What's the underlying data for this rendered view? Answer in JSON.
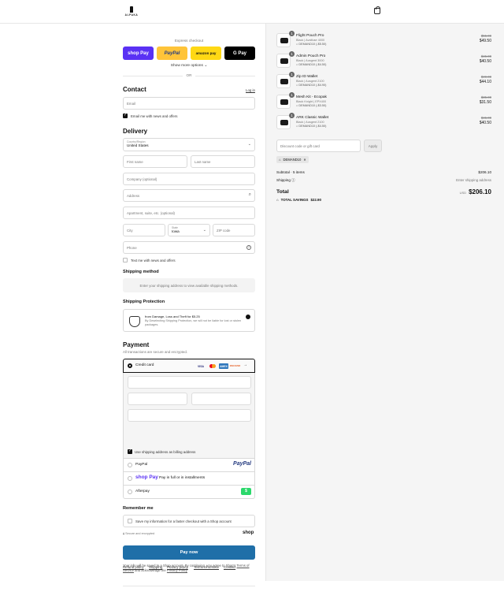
{
  "header": {
    "brand": "ALPAKA"
  },
  "express": {
    "title": "Express checkout",
    "buttons": [
      {
        "label": "shop Pay"
      },
      {
        "label": "PayPal"
      },
      {
        "label": "amazon pay"
      },
      {
        "label": "G Pay"
      }
    ],
    "more": "Show more options",
    "or": "OR"
  },
  "contact": {
    "title": "Contact",
    "login": "Log in",
    "email_placeholder": "Email",
    "news": "Email me with news and offers"
  },
  "delivery": {
    "title": "Delivery",
    "country_label": "Country/Region",
    "country_value": "United States",
    "first_name": "First name",
    "last_name": "Last name",
    "company": "Company (optional)",
    "address": "Address",
    "apartment": "Apartment, suite, etc. (optional)",
    "city": "City",
    "state_label": "State",
    "state_value": "Iowa",
    "zip": "ZIP code",
    "phone": "Phone",
    "text_news": "Text me with news and offers"
  },
  "shipping_method": {
    "title": "Shipping method",
    "notice": "Enter your shipping address to view available shipping methods."
  },
  "shipping_protection": {
    "title": "Shipping Protection",
    "line1": "from Damage, Loss and Theft for $5.25",
    "line2": "By Deselecting Shipping Protection, we will not be liable for lost or stolen packages."
  },
  "payment": {
    "title": "Payment",
    "subtitle": "All transactions are secure and encrypted.",
    "credit_card": "Credit card",
    "card_logos": [
      "VISA",
      "MC",
      "AMEX",
      "DISCOVER"
    ],
    "billing_same": "Use shipping address as billing address",
    "paypal": "PayPal",
    "paypal_logo": "PayPal",
    "shoppay_logo": "shop Pay",
    "shoppay_text": "Pay in full or in installments",
    "afterpay": "Afterpay",
    "afterpay_logo": "$"
  },
  "remember": {
    "title": "Remember me",
    "save": "Save my information for a faster checkout with a Shop account",
    "secure": "Secure and encrypted",
    "shop": "shop"
  },
  "pay_now": "Pay now",
  "legal": {
    "line1": "Your info will be saved to a Shop account. By continuing, you agree to Shop's",
    "terms": "Terms of Service",
    "mid": "and acknowledge the",
    "privacy": "Privacy Policy"
  },
  "footer": [
    "Refund policy",
    "Shipping",
    "Privacy policy",
    "Terms of service",
    "Contact"
  ],
  "products": [
    {
      "qty": "1",
      "name": "Flight Pouch Pro",
      "variant": "Black | Avalfuse 4000",
      "discount": "DEMAND10 (-$5.50)",
      "old": "$55.00",
      "price": "$49.50"
    },
    {
      "qty": "1",
      "name": "Admin Pouch Pro",
      "variant": "Black | Ausgent 3000",
      "discount": "DEMAND10 (-$4.50)",
      "old": "$45.00",
      "price": "$40.50"
    },
    {
      "qty": "1",
      "name": "Zip ID Wallet",
      "variant": "Black | Ausgent 2100",
      "discount": "DEMAND10 (-$4.90)",
      "old": "$49.00",
      "price": "$44.10"
    },
    {
      "qty": "1",
      "name": "Mesh Kit - Ecopak",
      "variant": "Black Knight | EPX400",
      "discount": "DEMAND10 (-$3.50)",
      "old": "$35.00",
      "price": "$31.50"
    },
    {
      "qty": "1",
      "name": "ARK Classic Wallet",
      "variant": "Black | Ausgent 2100",
      "discount": "DEMAND10 (-$4.50)",
      "old": "$45.00",
      "price": "$40.50"
    }
  ],
  "discount": {
    "placeholder": "Discount code or gift card",
    "apply": "Apply",
    "chip": "DEMAND10"
  },
  "summary": {
    "subtotal_label": "Subtotal · 5 items",
    "subtotal": "$206.10",
    "shipping_label": "Shipping",
    "shipping_value": "Enter shipping address",
    "total_label": "Total",
    "currency": "USD",
    "total": "$206.10",
    "savings_label": "TOTAL SAVINGS",
    "savings": "$22.90"
  },
  "colors": {
    "accent": "#1f6fa8",
    "shoppay": "#5a31f4",
    "paypal_yellow": "#ffc439",
    "amazon_yellow": "#ffd814"
  }
}
